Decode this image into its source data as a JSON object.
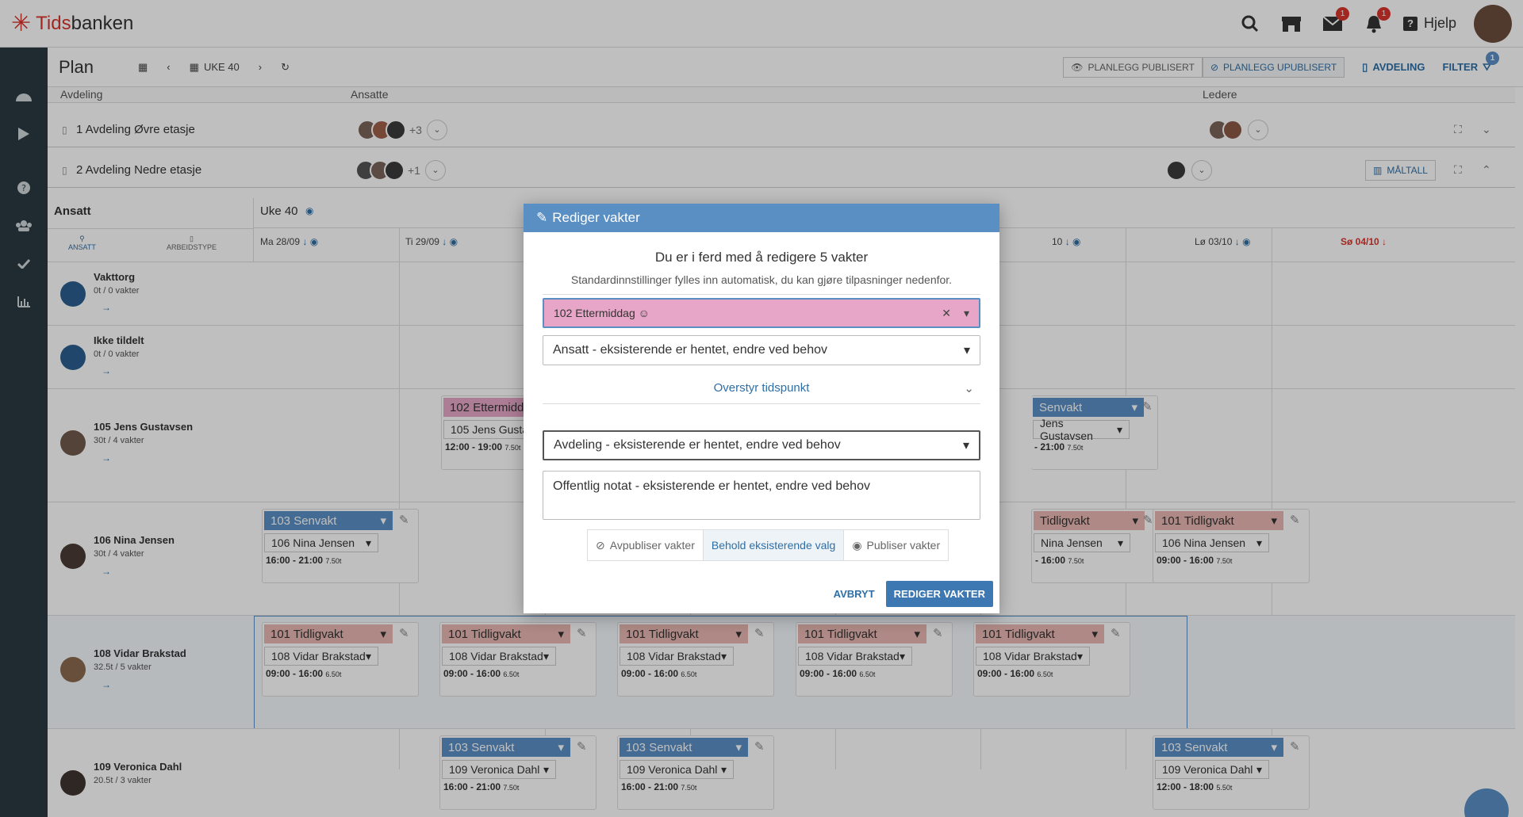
{
  "app": {
    "logo_text_1": "Tids",
    "logo_text_2": "banken",
    "help": "Hjelp",
    "mail_badge": "1",
    "bell_badge": "1"
  },
  "planbar": {
    "title": "Plan",
    "week_label": "UKE 40",
    "planlegg_publisert": "PLANLEGG PUBLISERT",
    "planlegg_upublisert": "PLANLEGG UPUBLISERT",
    "avdeling": "AVDELING",
    "filter": "FILTER",
    "filter_badge": "1"
  },
  "headers": {
    "avdeling": "Avdeling",
    "ansatte": "Ansatte",
    "ledere": "Ledere"
  },
  "departments": [
    {
      "label": "1 Avdeling Øvre etasje",
      "more": "+3"
    },
    {
      "label": "2 Avdeling Nedre etasje",
      "more": "+1",
      "maltall": "MÅLTALL"
    }
  ],
  "grid": {
    "ansatt_title": "Ansatt",
    "week_title": "Uke 40",
    "tab_ansatt": "ANSATT",
    "tab_arbeidstype": "ARBEIDSTYPE",
    "days": [
      "Ma 28/09",
      "Ti 29/09",
      "",
      "",
      "10",
      "Lø 03/10",
      "Sø 04/10"
    ],
    "day_colors": {
      "sunday": "#d9342b"
    }
  },
  "employees": [
    {
      "name": "Vakttorg",
      "sub": "0t / 0 vakter"
    },
    {
      "name": "Ikke tildelt",
      "sub": "0t / 0 vakter"
    },
    {
      "name": "105 Jens Gustavsen",
      "sub": "30t / 4 vakter"
    },
    {
      "name": "106 Nina Jensen",
      "sub": "30t / 4 vakter"
    },
    {
      "name": "108 Vidar Brakstad",
      "sub": "32.5t / 5 vakter"
    },
    {
      "name": "109 Veronica Dahl",
      "sub": "20.5t / 3 vakter"
    }
  ],
  "shifts": {
    "jens_ti": {
      "type": "102 Ettermidda",
      "emp": "105 Jens Gusta",
      "time": "12:00 - 19:00",
      "hrs": "7.50t"
    },
    "jens_fr": {
      "type": "Senvakt",
      "emp": "Jens Gustavsen",
      "time": "- 21:00",
      "hrs": "7.50t"
    },
    "nina_ma": {
      "type": "103 Senvakt",
      "emp": "106 Nina Jensen",
      "time": "16:00 - 21:00",
      "hrs": "7.50t"
    },
    "nina_fr": {
      "type": "Tidligvakt",
      "emp": "Nina Jensen",
      "time": "- 16:00",
      "hrs": "7.50t"
    },
    "nina_lo": {
      "type": "101 Tidligvakt",
      "emp": "106 Nina Jensen",
      "time": "09:00 - 16:00",
      "hrs": "7.50t"
    },
    "vidar": {
      "type": "101 Tidligvakt",
      "emp": "108 Vidar Brakstad",
      "time": "09:00 - 16:00",
      "hrs": "6.50t"
    },
    "vero_ti": {
      "type": "103 Senvakt",
      "emp": "109 Veronica Dahl",
      "time": "16:00 - 21:00",
      "hrs": "7.50t"
    },
    "vero_lo": {
      "type": "103 Senvakt",
      "emp": "109 Veronica Dahl",
      "time": "12:00 - 18:00",
      "hrs": "5.50t"
    }
  },
  "modal": {
    "header": "Rediger vakter",
    "title": "Du er i ferd med å redigere 5 vakter",
    "subtitle": "Standardinnstillinger fylles inn automatisk, du kan gjøre tilpasninger nedenfor.",
    "shifttype": "102 Ettermiddag",
    "ansatt": "Ansatt - eksisterende er hentet, endre ved behov",
    "override": "Overstyr tidspunkt",
    "avdeling": "Avdeling - eksisterende er hentet, endre ved behov",
    "notat": "Offentlig notat - eksisterende er hentet, endre ved behov",
    "seg_unpublish": "Avpubliser vakter",
    "seg_keep": "Behold eksisterende valg",
    "seg_publish": "Publiser vakter",
    "cancel": "AVBRYT",
    "submit": "REDIGER VAKTER"
  }
}
